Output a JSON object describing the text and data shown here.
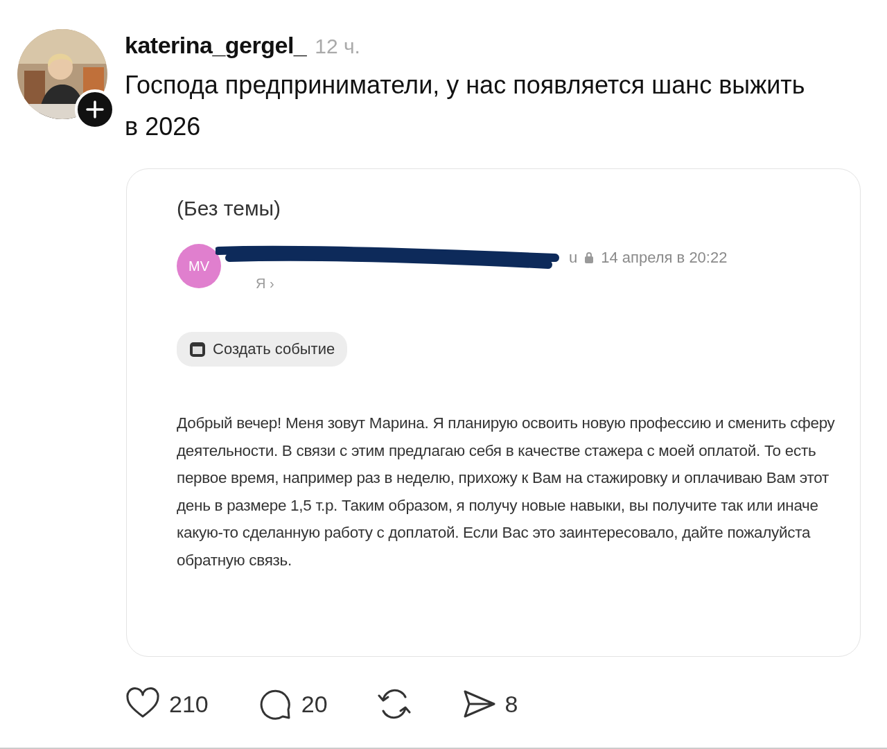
{
  "post": {
    "author": "katerina_gergel_",
    "time": "12 ч.",
    "text": "Господа предприниматели, у нас появляется шанс выжить в 2026"
  },
  "email": {
    "subject": "(Без темы)",
    "sender_initials": "MV",
    "sender_tail": "u",
    "date": "14 апреля в 20:22",
    "recipient": "Я ›",
    "event_button": "Создать событие",
    "body": "Добрый вечер! Меня зовут Марина. Я планирую освоить новую профессию и сменить сферу деятельности. В связи с этим предлагаю себя в качестве стажера с моей оплатой. То есть первое время, например раз в неделю, прихожу к Вам на стажировку и оплачиваю Вам этот день в размере 1,5 т.р. Таким образом, я получу новые навыки, вы получите так или иначе какую-то сделанную работу с доплатой. Если Вас это заинтересовало, дайте пожалуйста обратную связь."
  },
  "actions": [
    {
      "kind": "like",
      "count": "210"
    },
    {
      "kind": "comment",
      "count": "20"
    },
    {
      "kind": "repost"
    },
    {
      "kind": "share",
      "count": "8"
    }
  ]
}
